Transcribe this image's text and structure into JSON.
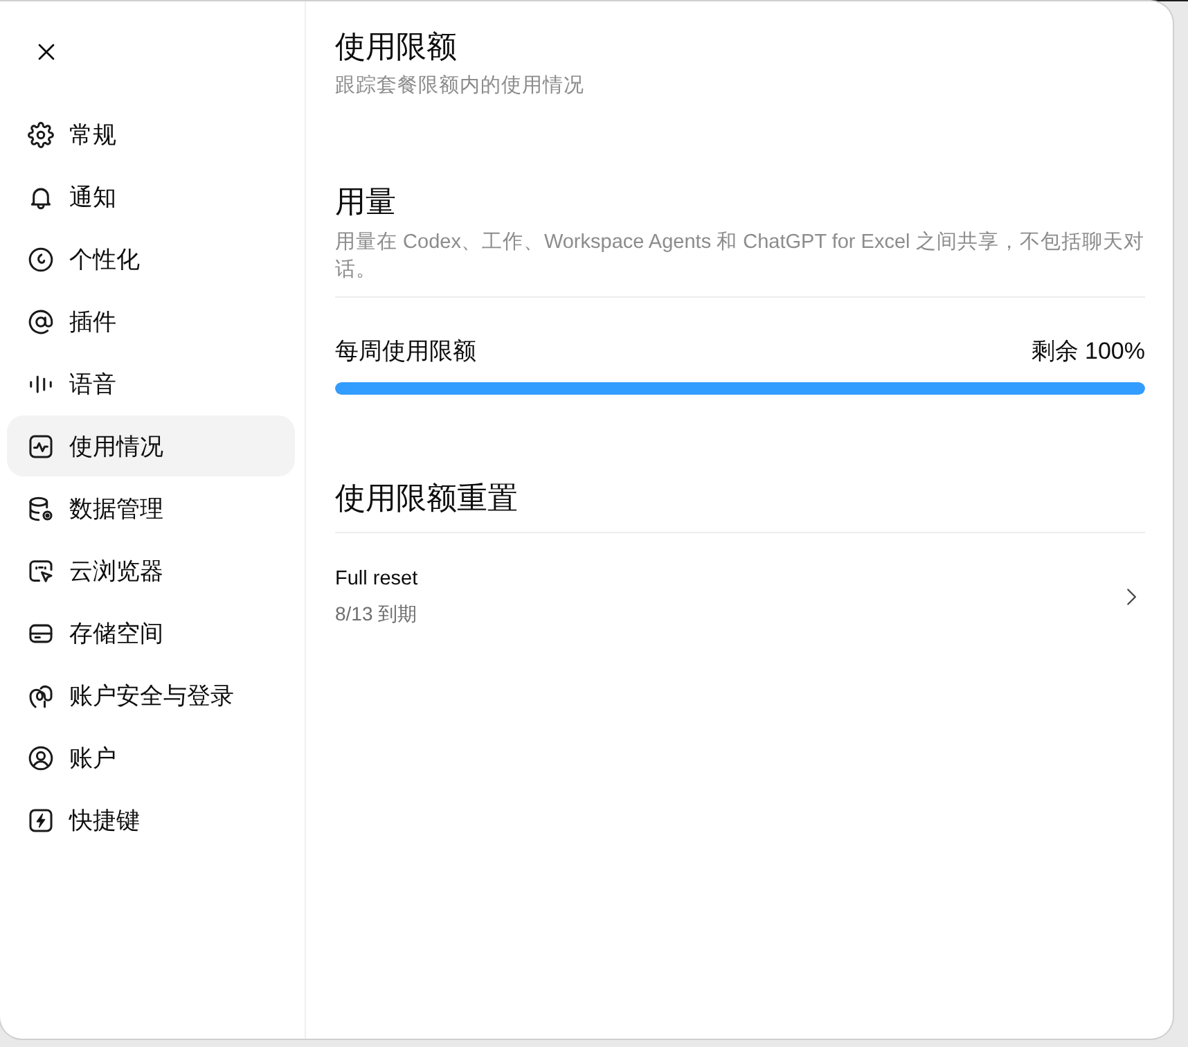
{
  "sidebar": {
    "items": [
      {
        "label": "常规",
        "selected": false
      },
      {
        "label": "通知",
        "selected": false
      },
      {
        "label": "个性化",
        "selected": false
      },
      {
        "label": "插件",
        "selected": false
      },
      {
        "label": "语音",
        "selected": false
      },
      {
        "label": "使用情况",
        "selected": true
      },
      {
        "label": "数据管理",
        "selected": false
      },
      {
        "label": "云浏览器",
        "selected": false
      },
      {
        "label": "存储空间",
        "selected": false
      },
      {
        "label": "账户安全与登录",
        "selected": false
      },
      {
        "label": "账户",
        "selected": false
      },
      {
        "label": "快捷键",
        "selected": false
      }
    ]
  },
  "page": {
    "title": "使用限额",
    "subtitle": "跟踪套餐限额内的使用情况"
  },
  "sections": [
    {
      "kind": "usage",
      "heading": "用量",
      "description": "用量在 Codex、工作、Workspace Agents 和 ChatGPT for Excel 之间共享，不包括聊天对话。",
      "meters": [
        {
          "label": "每周使用限额",
          "reading": "剩余 100%",
          "level": 1
        }
      ]
    },
    {
      "kind": "resets",
      "heading": "使用限额重置",
      "rows": [
        {
          "title": "Full reset",
          "detail": "8/13 到期"
        }
      ]
    }
  ]
}
